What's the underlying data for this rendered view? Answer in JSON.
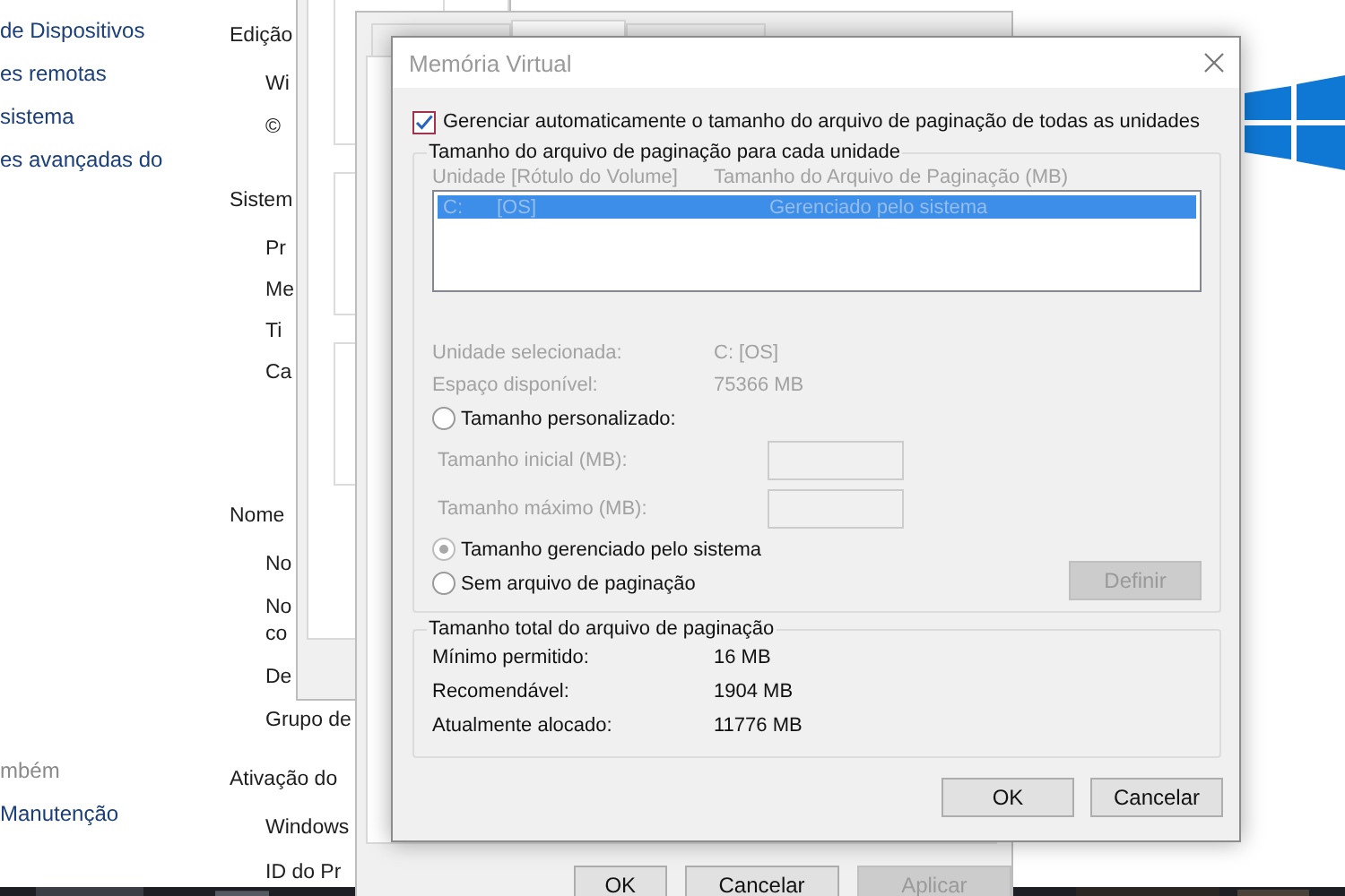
{
  "control_panel": {
    "sidebar_links": [
      "de Dispositivos",
      "es remotas",
      "sistema",
      "es avançadas do"
    ],
    "see_also": {
      "heading": "mbém",
      "links": [
        "Manutenção"
      ]
    },
    "sections": [
      {
        "heading": "Edição",
        "items": [
          [
            "Wi"
          ],
          [
            "©"
          ]
        ]
      },
      {
        "heading": "Sistem",
        "items": [
          [
            "Pr"
          ],
          [
            "Me"
          ],
          [
            "Ti"
          ],
          [
            "Ca"
          ]
        ]
      },
      {
        "heading": "Nome",
        "items": [
          [
            "No"
          ],
          [
            "No",
            "co"
          ],
          [
            "De"
          ],
          [
            "Grupo de"
          ]
        ]
      },
      {
        "heading": "Ativação do",
        "items": [
          [
            "Windows"
          ],
          [
            "ID do Pr"
          ]
        ]
      }
    ]
  },
  "system_properties": {
    "tabs": [
      {
        "selected": false
      },
      {
        "selected": true
      },
      {
        "selected": false
      }
    ],
    "buttons": [
      {
        "label": "OK",
        "disabled": false
      },
      {
        "label": "Cancelar",
        "disabled": false
      },
      {
        "label": "Aplicar",
        "disabled": true
      }
    ]
  },
  "dialog": {
    "title": "Memória Virtual",
    "auto_manage": {
      "label": "Gerenciar automaticamente o tamanho do arquivo de paginação de todas as unidades",
      "checked": true
    },
    "per_drive": {
      "title": "Tamanho do arquivo de paginação para cada unidade",
      "columns": [
        "Unidade [Rótulo do Volume]",
        "Tamanho do Arquivo de Paginação (MB)"
      ],
      "drives": [
        {
          "drive": "C:",
          "label": "[OS]",
          "size": "Gerenciado pelo sistema",
          "selected": true
        }
      ],
      "details": [
        {
          "label": "Unidade selecionada:",
          "value": "C:  [OS]"
        },
        {
          "label": "Espaço disponível:",
          "value": "75366 MB"
        }
      ],
      "options": [
        {
          "kind": "radio",
          "label": "Tamanho personalizado:",
          "selected": false
        },
        {
          "kind": "field",
          "label": "Tamanho inicial (MB):",
          "disabled": true
        },
        {
          "kind": "field",
          "label": "Tamanho máximo (MB):",
          "disabled": true
        },
        {
          "kind": "radio",
          "label": "Tamanho gerenciado pelo sistema",
          "selected": true
        },
        {
          "kind": "radio",
          "label": "Sem arquivo de paginação",
          "selected": false
        }
      ],
      "set_button": {
        "label": "Definir",
        "disabled": true
      }
    },
    "total": {
      "title": "Tamanho total do arquivo de paginação",
      "rows": [
        {
          "label": "Mínimo permitido:",
          "value": "16 MB"
        },
        {
          "label": "Recomendável:",
          "value": "1904 MB"
        },
        {
          "label": "Atualmente alocado:",
          "value": "11776 MB"
        }
      ]
    },
    "buttons": [
      {
        "label": "OK"
      },
      {
        "label": "Cancelar"
      }
    ]
  }
}
